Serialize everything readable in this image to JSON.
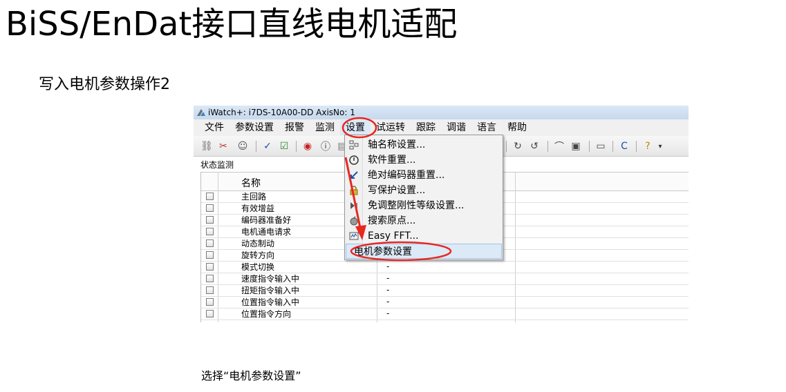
{
  "slide": {
    "title": "BiSS/EnDat接口直线电机适配",
    "subtitle": "写入电机参数操作2",
    "caption": "选择“电机参数设置”"
  },
  "window": {
    "title": "iWatch+: i7DS-10A00-DD  AxisNo: 1",
    "menu": [
      "文件",
      "参数设置",
      "报警",
      "监测",
      "设置",
      "试运转",
      "跟踪",
      "调谐",
      "语言",
      "帮助"
    ],
    "highlighted_menu": "设置"
  },
  "panel": {
    "label": "状态监测",
    "column_name": "名称",
    "rows": [
      {
        "name": "主回路",
        "value": ""
      },
      {
        "name": "有效增益",
        "value": ""
      },
      {
        "name": "编码器准备好",
        "value": ""
      },
      {
        "name": "电机通电请求",
        "value": ""
      },
      {
        "name": "动态制动",
        "value": ""
      },
      {
        "name": "旋转方向",
        "value": ""
      },
      {
        "name": "模式切换",
        "value": "-"
      },
      {
        "name": "速度指令输入中",
        "value": "-"
      },
      {
        "name": "扭矩指令输入中",
        "value": "-"
      },
      {
        "name": "位置指令输入中",
        "value": "-"
      },
      {
        "name": "位置指令方向",
        "value": "-"
      }
    ]
  },
  "dropdown": {
    "items": [
      {
        "label": "轴名称设置...",
        "icon": "axis-name-icon"
      },
      {
        "label": "软件重置...",
        "icon": "software-reset-icon"
      },
      {
        "label": "绝对编码器重置...",
        "icon": "encoder-reset-icon"
      },
      {
        "label": "写保护设置...",
        "icon": "write-protect-icon"
      },
      {
        "label": "免调整刚性等级设置...",
        "icon": "rigidity-icon"
      },
      {
        "label": "搜索原点...",
        "icon": "origin-search-icon"
      },
      {
        "label": "Easy FFT...",
        "icon": "fft-icon"
      },
      {
        "label": "电机参数设置",
        "icon": ""
      }
    ],
    "selected": "电机参数设置"
  },
  "annotation_color": "#e8271f"
}
